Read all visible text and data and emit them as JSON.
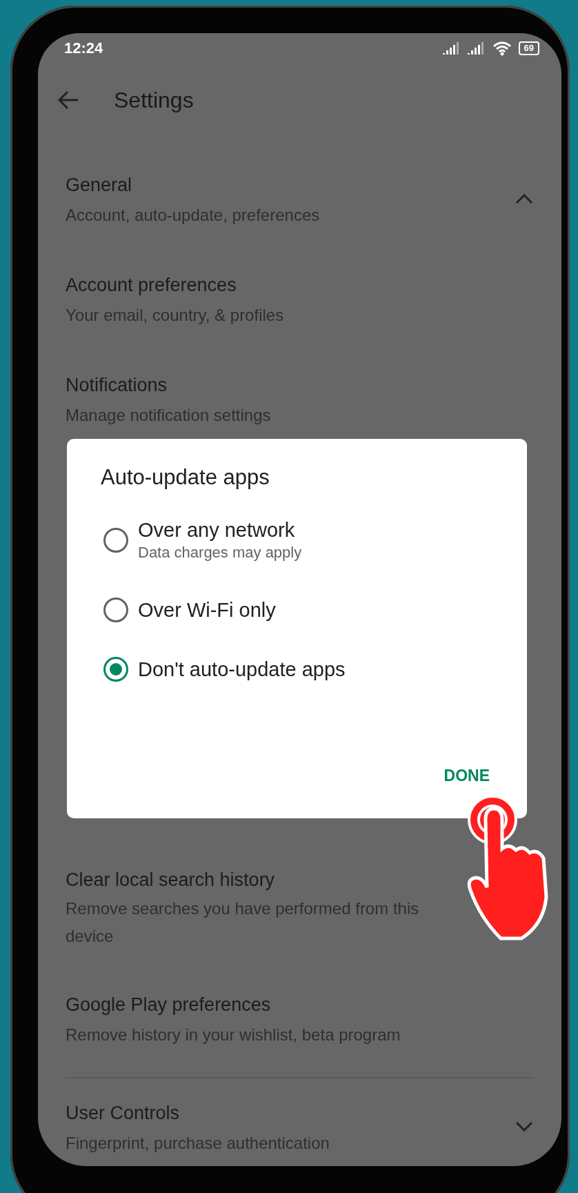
{
  "status_bar": {
    "time": "12:24",
    "battery": "69"
  },
  "header": {
    "title": "Settings"
  },
  "general": {
    "title": "General",
    "subtitle": "Account, auto-update, preferences",
    "expanded": true
  },
  "items_above": [
    {
      "title": "Account preferences",
      "subtitle": "Your email, country, & profiles"
    },
    {
      "title": "Notifications",
      "subtitle": "Manage notification settings"
    }
  ],
  "items_below": [
    {
      "title": "Clear local search history",
      "subtitle": "Remove searches you have performed from this device"
    },
    {
      "title": "Google Play preferences",
      "subtitle": "Remove history in your wishlist, beta program"
    }
  ],
  "user_controls": {
    "title": "User Controls",
    "subtitle": "Fingerprint, purchase authentication",
    "expanded": false
  },
  "dialog": {
    "title": "Auto-update apps",
    "options": [
      {
        "label": "Over any network",
        "description": "Data charges may apply",
        "selected": false
      },
      {
        "label": "Over Wi-Fi only",
        "selected": false
      },
      {
        "label": "Don't auto-update apps",
        "selected": true
      }
    ],
    "done_button": "DONE"
  }
}
